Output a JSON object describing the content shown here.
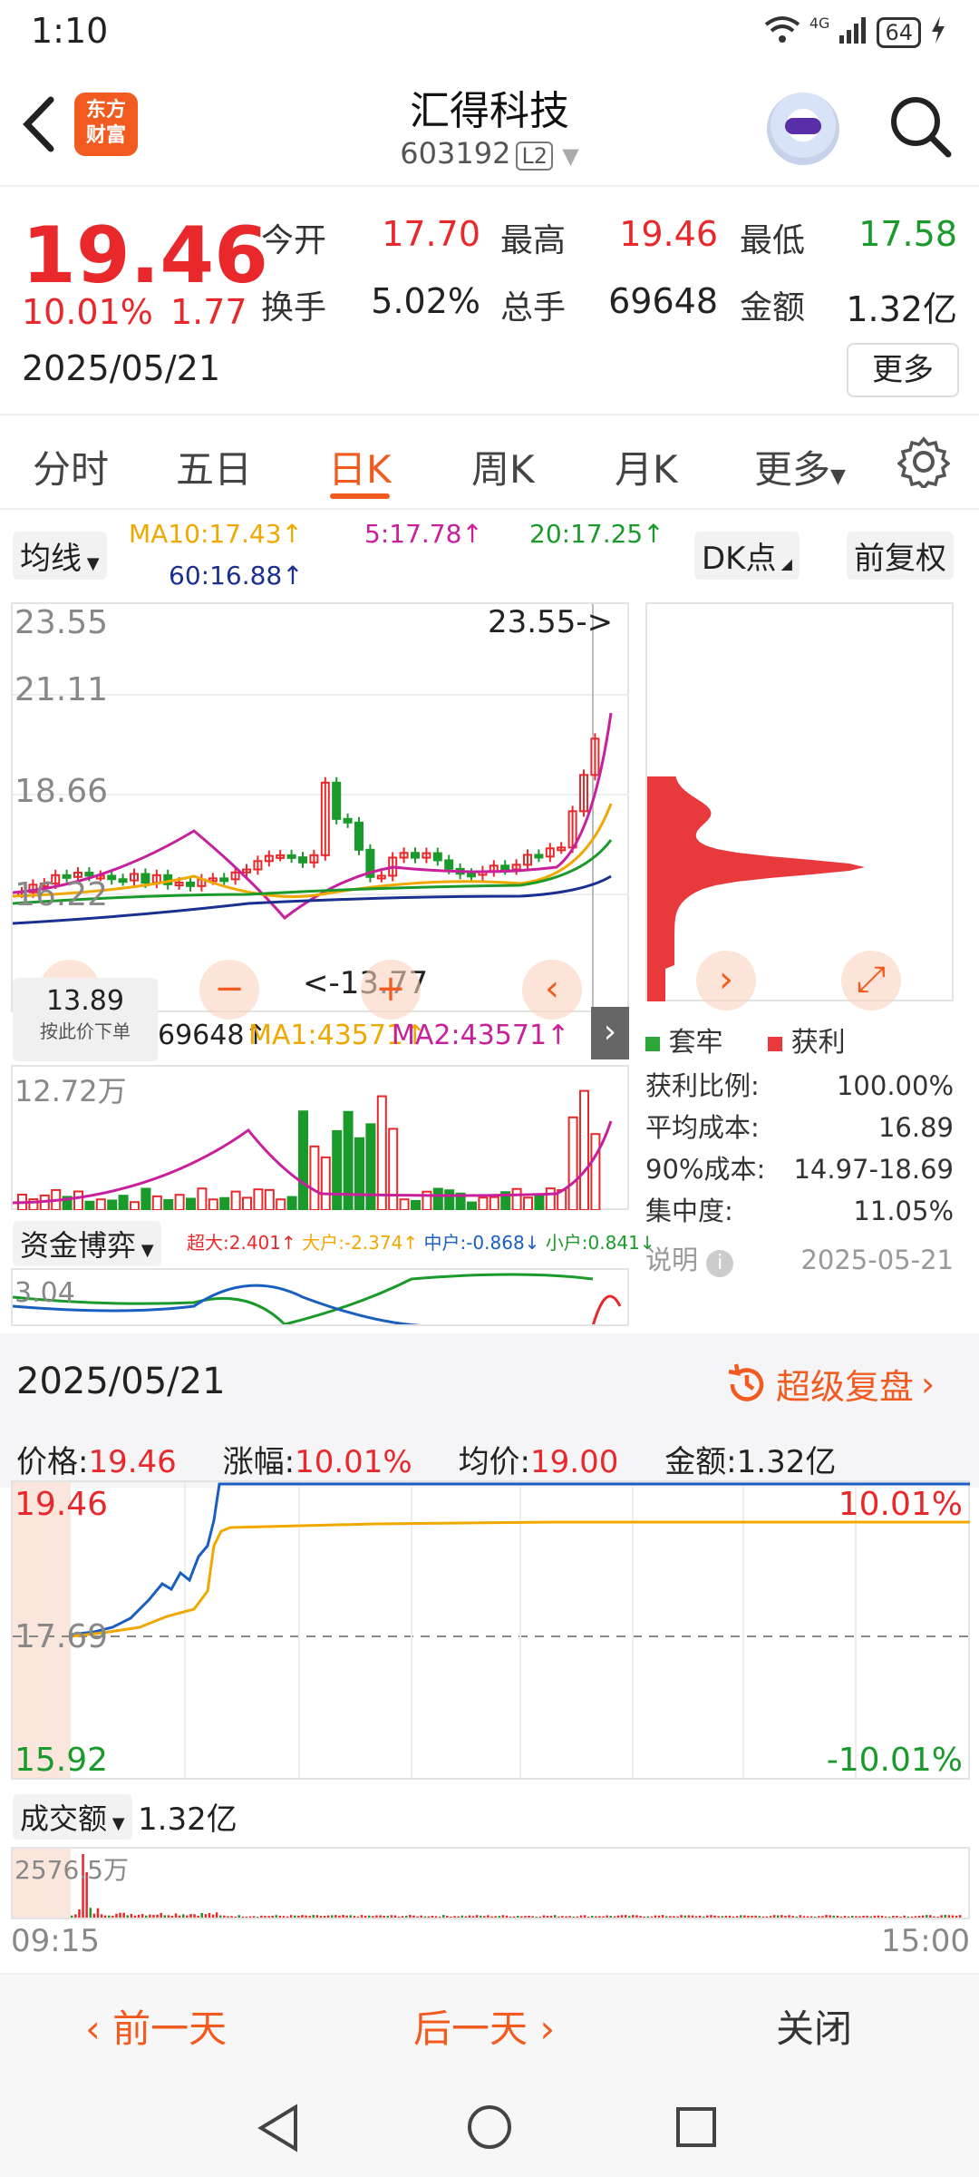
{
  "status": {
    "time": "1:10",
    "battery": "64",
    "network": "4G"
  },
  "header": {
    "logo_line1": "东方",
    "logo_line2": "财富",
    "title": "汇得科技",
    "code": "603192",
    "level": "L2"
  },
  "quote": {
    "price": "19.46",
    "change_pct": "10.01%",
    "change": "1.77",
    "date": "2025/05/21",
    "open_label": "今开",
    "open": "17.70",
    "high_label": "最高",
    "high": "19.46",
    "low_label": "最低",
    "low": "17.58",
    "turnover_label": "换手",
    "turnover": "5.02%",
    "volume_label": "总手",
    "volume": "69648",
    "amount_label": "金额",
    "amount": "1.32亿",
    "more_label": "更多"
  },
  "tabs": [
    "分时",
    "五日",
    "日K",
    "周K",
    "月K",
    "更多"
  ],
  "active_tab": "日K",
  "kline": {
    "ma_selector": "均线",
    "ma10": "MA10:17.43↑",
    "ma5": "5:17.78↑",
    "ma20": "20:17.25↑",
    "ma60": "60:16.88↑",
    "dk_label": "DK点",
    "fq_label": "前复权",
    "y_top": "23.55",
    "y_2": "21.11",
    "y_3": "18.66",
    "y_4": "16.22",
    "max_marker": "23.55->",
    "min_marker": "<-13.77",
    "cursor_price": "13.89",
    "cursor_hint": "按此价下单",
    "vol_line": "69648↑",
    "vol_ma1": "MA1:43571↑",
    "vol_ma2": "MA2:43571↑",
    "vol_top": "12.72万",
    "fund_selector": "资金博弈",
    "fund_super": "超大:2.401↑",
    "fund_big": "大户:-2.374↑",
    "fund_mid": "中户:-0.868↓",
    "fund_small": "小户:0.841↓",
    "fund_top": "3.04"
  },
  "chips": {
    "legend_trapped": "套牢",
    "legend_profit": "获利",
    "rows": [
      {
        "label": "获利比例:",
        "value": "100.00%"
      },
      {
        "label": "平均成本:",
        "value": "16.89"
      },
      {
        "label": "90%成本:",
        "value": "14.97-18.69"
      },
      {
        "label": "集中度:",
        "value": "11.05%"
      }
    ],
    "note_label": "说明",
    "note_date": "2025-05-21"
  },
  "detail": {
    "date": "2025/05/21",
    "replay_label": "超级复盘",
    "price_label": "价格:",
    "price": "19.46",
    "change_label": "涨幅:",
    "change": "10.01%",
    "avg_label": "均价:",
    "avg": "19.00",
    "amount_label": "金额:",
    "amount": "1.32亿",
    "y_top": "19.46",
    "y_mid": "17.69",
    "y_bot": "15.92",
    "pct_top": "10.01%",
    "pct_bot": "-10.01%",
    "vol_selector": "成交额",
    "vol_total": "1.32亿",
    "vol_top": "2576.5万",
    "t_start": "09:15",
    "t_end": "15:00"
  },
  "footer": {
    "prev": "前一天",
    "next": "后一天",
    "close": "关闭"
  },
  "colors": {
    "up": "#e8282b",
    "down": "#1a9a2a",
    "accent": "#f25b1f"
  }
}
